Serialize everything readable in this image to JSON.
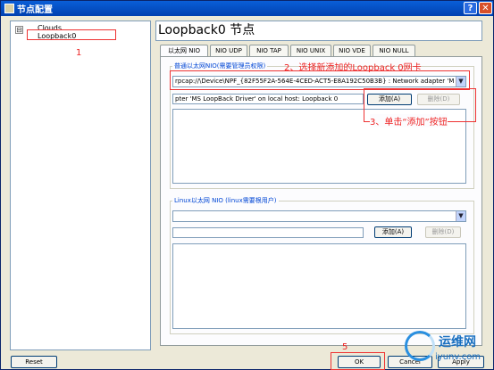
{
  "window": {
    "title": "节点配置",
    "help_label": "?",
    "close_label": "✕"
  },
  "tree": {
    "expander": "⊟",
    "root": "Clouds",
    "child": "Loopback0"
  },
  "header": {
    "title": "Loopback0 节点"
  },
  "tabs": [
    "以太网 NIO",
    "NIO UDP",
    "NIO TAP",
    "NIO UNIX",
    "NIO VDE",
    "NIO NULL"
  ],
  "ethernet": {
    "group_label": "普通以太网NIO(需要管理员权限)",
    "adapter_value": "rpcap://\\Device\\NPF_{82F55F2A-564E-4CED-ACT5-E8A192C50B3B} : Network adapter 'M",
    "entry_value": "pter 'MS LoopBack Driver' on local host: Loopback 0",
    "add_label": "添加(A)",
    "delete_label": "删除(D)"
  },
  "linux": {
    "group_label": "Linux以太网 NIO (linux需要根用户)",
    "add_label": "添加(A)",
    "delete_label": "删除(D)"
  },
  "footer": {
    "reset_label": "Reset",
    "ok_label": "OK",
    "cancel_label": "Cancel",
    "apply_label": "Apply"
  },
  "annotations": {
    "a1": "1",
    "a2": "2、选择新添加的Loopback 0网卡",
    "a3": "3、单击“添加”按钮",
    "a5": "5"
  },
  "watermark": {
    "brand": "运维网",
    "url": "iyunv.com"
  },
  "colors": {
    "annotation": "#e33333",
    "title_bar": "#0a5fd8",
    "group_label": "#0046d5"
  }
}
